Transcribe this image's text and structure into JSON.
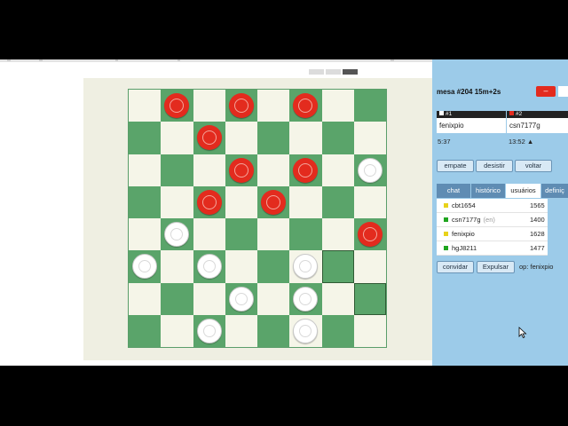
{
  "site": {
    "tabs": [
      "",
      "",
      ""
    ],
    "active_tab": 2
  },
  "board": {
    "size": 8,
    "top_left_color": "light",
    "colors": {
      "light": "#f5f5e8",
      "dark": "#5aa46a",
      "red": "#e32b1e",
      "white": "#ffffff"
    },
    "rows": [
      ".r.r.r..",
      "..r.....",
      "...r.r.w",
      "..r.r...",
      ".w.....r",
      "w.w..w..",
      "...w.w..",
      "..w..w.."
    ],
    "highlighted_squares": [
      [
        5,
        6
      ],
      [
        6,
        7
      ]
    ]
  },
  "panel": {
    "table_title": "mesa #204  15m+2s",
    "leave_label": "–",
    "players": [
      {
        "slot": "#1",
        "name": "fenixpio",
        "clock": "5:37",
        "color": "#ffffff"
      },
      {
        "slot": "#2",
        "name": "csn7177g",
        "clock": "13:52 ▲",
        "color": "#e32b1e"
      }
    ],
    "actions": {
      "draw": "empate",
      "resign": "desistir",
      "undo": "voltar"
    },
    "tabs": [
      "chat",
      "histórico",
      "usuários",
      "definiç"
    ],
    "active_tab": 2,
    "users": [
      {
        "name": "cbt1654",
        "tag": "",
        "rating": "1565",
        "status_color": "#e8d21a"
      },
      {
        "name": "csn7177g",
        "tag": "(en)",
        "rating": "1400",
        "status_color": "#1fa51f"
      },
      {
        "name": "fenixpio",
        "tag": "",
        "rating": "1628",
        "status_color": "#e8d21a"
      },
      {
        "name": "hgJ8211",
        "tag": "",
        "rating": "1477",
        "status_color": "#1fa51f"
      }
    ],
    "invite": "convidar",
    "kick": "Expulsar",
    "operator": "op: fenixpio"
  }
}
